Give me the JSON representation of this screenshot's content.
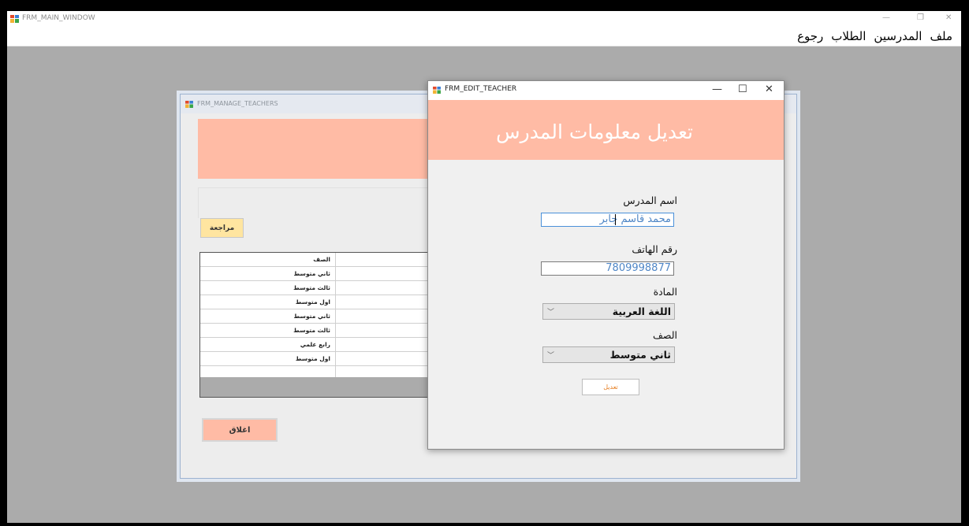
{
  "main_window": {
    "title": "FRM_MAIN_WINDOW",
    "controls": {
      "minimize": "—",
      "restore": "❐",
      "close": "✕"
    },
    "menu": [
      "ملف",
      "المدرسين",
      "الطلاب",
      "رجوع"
    ]
  },
  "manage_window": {
    "title": "FRM_MANAGE_TEACHERS",
    "review_label": "مراجعة",
    "grid": {
      "header": "الصف",
      "rows": [
        "ثاني متوسط",
        "ثالث متوسط",
        "اول متوسط",
        "ثاني متوسط",
        "ثالث متوسط",
        "رابع علمي",
        "اول متوسط",
        ""
      ]
    },
    "close_label": "اغلاق"
  },
  "edit_window": {
    "title": "FRM_EDIT_TEACHER",
    "controls": {
      "minimize": "—",
      "maximize": "☐",
      "close": "✕"
    },
    "heading": "تعديل معلومات المدرس",
    "name_label": "اسم المدرس",
    "name_value": "محمد قاسم جابر",
    "phone_label": "رقم الهاتف",
    "phone_value": "7809998877",
    "subject_label": "المادة",
    "subject_value": "اللغة العربية",
    "grade_label": "الصف",
    "grade_value": "ثاني متوسط",
    "submit_label": "تعديل"
  },
  "colors": {
    "accent": "#ffbba5",
    "review_button": "#ffe5a0",
    "background": "#ababab"
  }
}
